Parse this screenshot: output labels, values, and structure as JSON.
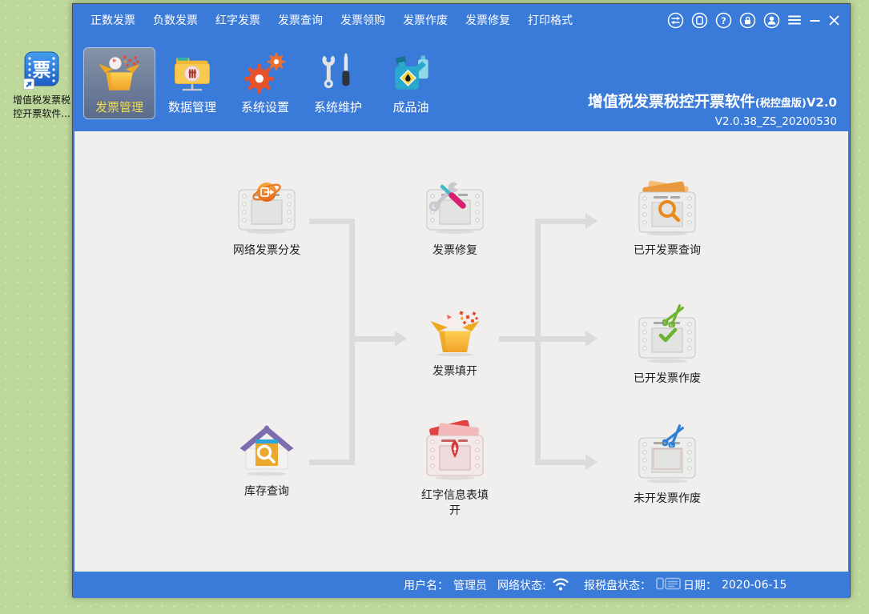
{
  "desktop": {
    "shortcut": {
      "icon": "invoice-app-icon",
      "label_line1": "增值税发票税",
      "label_line2": "控开票软件..."
    }
  },
  "menu": {
    "items": [
      "正数发票",
      "负数发票",
      "红字发票",
      "发票查询",
      "发票领购",
      "发票作废",
      "发票修复",
      "打印格式"
    ]
  },
  "titlebar_controls": {
    "icons": [
      "switch-user-icon",
      "clipboard-icon",
      "help-icon",
      "lock-icon",
      "account-icon",
      "menu-icon",
      "minimize-icon",
      "close-icon"
    ]
  },
  "toolbar": {
    "items": [
      {
        "label": "发票管理",
        "icon": "open-box-icon",
        "selected": true
      },
      {
        "label": "数据管理",
        "icon": "folder-data-icon",
        "selected": false
      },
      {
        "label": "系统设置",
        "icon": "gears-icon",
        "selected": false
      },
      {
        "label": "系统维护",
        "icon": "wrench-screwdriver-icon",
        "selected": false
      },
      {
        "label": "成品油",
        "icon": "oil-can-icon",
        "selected": false
      }
    ]
  },
  "app_title": {
    "main": "增值税发票税控开票软件",
    "edition": "(税控盘版)",
    "version": "V2.0",
    "build": "V2.0.38_ZS_20200530"
  },
  "flowchart": {
    "nodes": [
      {
        "label": "网络发票分发",
        "icon": "invoice-globe-icon"
      },
      {
        "label": "发票修复",
        "icon": "invoice-repair-icon"
      },
      {
        "label": "已开发票查询",
        "icon": "invoice-search-icon"
      },
      {
        "label": "发票填开",
        "icon": "open-box-icon"
      },
      {
        "label": "已开发票作废",
        "icon": "invoice-scissors-check-icon"
      },
      {
        "label": "库存查询",
        "icon": "house-search-icon"
      },
      {
        "label": "红字信息表填开",
        "icon": "red-invoice-pen-icon"
      },
      {
        "label": "未开发票作废",
        "icon": "invoice-scissors-blue-icon"
      }
    ]
  },
  "statusbar": {
    "user_label": "用户名：",
    "user_value": "管理员",
    "network_label": "网络状态:",
    "network_icon": "wifi-icon",
    "tax_disk_label": "报税盘状态：",
    "tax_disk_icon": "tax-disk-icon",
    "date_label": "日期：",
    "date_value": "2020-06-15"
  },
  "colors": {
    "chrome_blue": "#3a7ad8",
    "desktop_green": "#bdd89b",
    "content_bg": "#f0efed",
    "selected_label": "#f2da4e",
    "connector_gray": "#dbdbd9"
  }
}
